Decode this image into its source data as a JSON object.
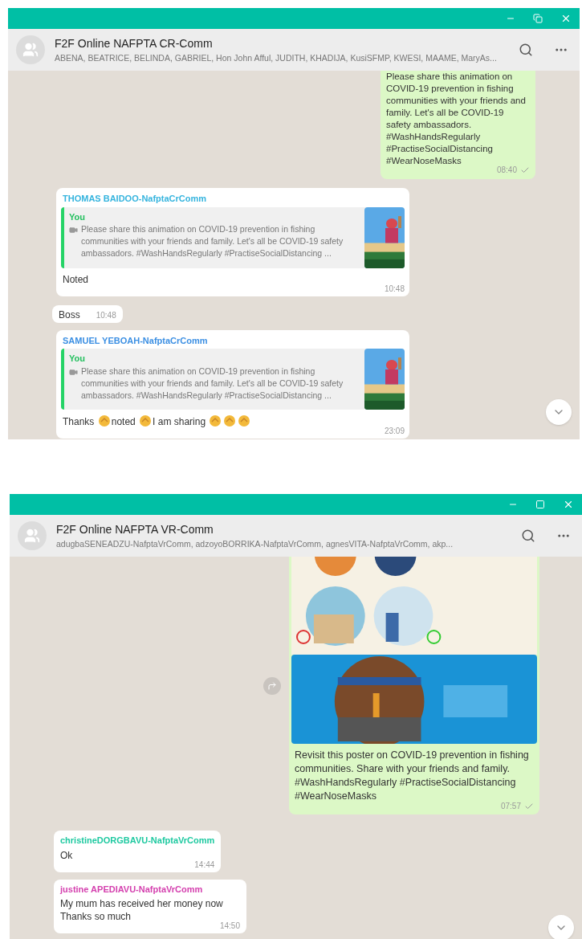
{
  "windows": [
    {
      "maximized": true,
      "title": "F2F Online NAFPTA CR-Comm",
      "members": "ABENA, BEATRICE, BELINDA, GABRIEL, Hon John Afful, JUDITH, KHADIJA, KusiSFMP, KWESI, MAAME, MaryAs...",
      "messages": [
        {
          "kind": "outgoing",
          "text": "Please share this animation on COVID-19 prevention in fishing communities with your friends and family. Let's all be COVID-19 safety ambassadors. #WashHandsRegularly #PractiseSocialDistancing #WearNoseMasks",
          "time": "08:40",
          "ticked": true
        },
        {
          "kind": "reply",
          "sender": "THOMAS BAIDOO-NafptaCrComm",
          "color": "#35b4de",
          "quote_author": "You",
          "quote": "Please share this animation on COVID-19 prevention in fishing communities with your friends and family. Let's all be COVID-19 safety ambassadors. #WashHandsRegularly #PractiseSocialDistancing ...",
          "parts": [
            {
              "kind": "text",
              "text": "Noted"
            }
          ],
          "time": "10:48"
        },
        {
          "kind": "incoming",
          "parts": [
            {
              "kind": "text",
              "text": "Boss"
            }
          ],
          "time": "10:48"
        },
        {
          "kind": "reply",
          "sender": "SAMUEL YEBOAH-NafptaCrComm",
          "color": "#3b8fe3",
          "quote_author": "You",
          "quote": "Please share this animation on COVID-19 prevention in fishing communities with your friends and family. Let's all be COVID-19 safety ambassadors. #WashHandsRegularly #PractiseSocialDistancing ...",
          "parts": [
            {
              "kind": "text",
              "text": "Thanks"
            },
            {
              "kind": "emoji"
            },
            {
              "kind": "text",
              "text": "noted"
            },
            {
              "kind": "emoji"
            },
            {
              "kind": "text",
              "text": "I am sharing"
            },
            {
              "kind": "emoji"
            },
            {
              "kind": "emoji"
            },
            {
              "kind": "emoji"
            }
          ],
          "time": "23:09"
        }
      ]
    },
    {
      "maximized": false,
      "title": "F2F Online NAFPTA VR-Comm",
      "members": "adugbaSENEADZU-NafptaVrComm, adzoyoBORRIKA-NafptaVrComm, agnesVITA-NafptaVrComm, akp...",
      "messages": [
        {
          "kind": "outgoing_image",
          "text": "Revisit this poster on COVID-19 prevention in fishing communities. Share with your friends and family. #WashHandsRegularly #PractiseSocialDistancing #WearNoseMasks",
          "time": "07:57",
          "ticked": true
        },
        {
          "kind": "incoming",
          "sender": "christineDORGBAVU-NafptaVrComm",
          "color": "#1ec9a0",
          "parts": [
            {
              "kind": "text",
              "text": "Ok"
            }
          ],
          "time": "14:44"
        },
        {
          "kind": "incoming",
          "sender": "justine APEDIAVU-NafptaVrComm",
          "color": "#d43fae",
          "parts": [
            {
              "kind": "text",
              "text": "My mum has received her money now Thanks so much"
            }
          ],
          "time": "14:50"
        }
      ]
    }
  ]
}
